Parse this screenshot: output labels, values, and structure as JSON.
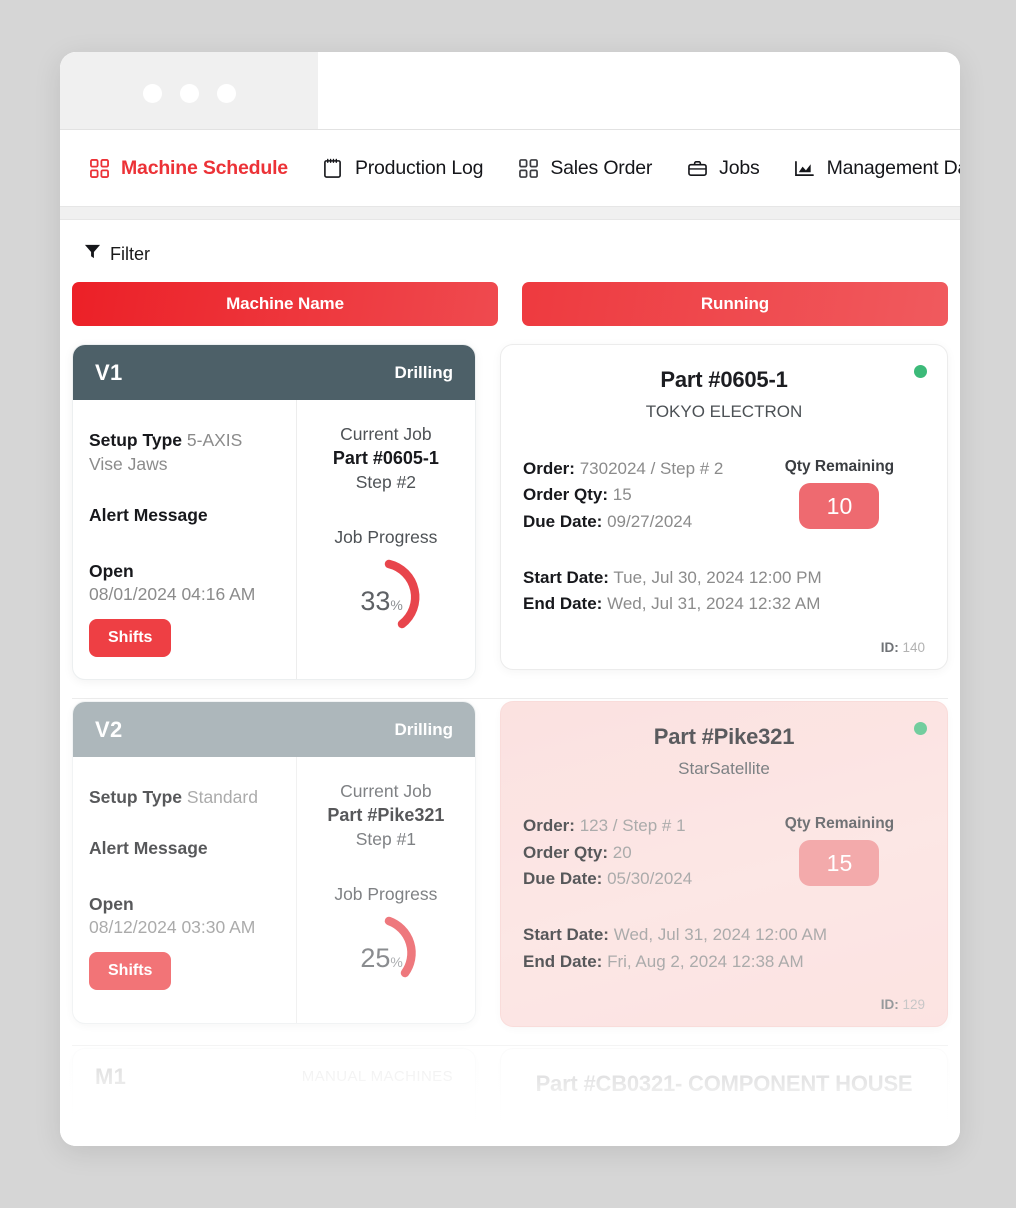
{
  "nav": {
    "items": [
      {
        "label": "Machine Schedule",
        "icon": "grid-icon",
        "active": true
      },
      {
        "label": "Production Log",
        "icon": "notepad-icon",
        "active": false
      },
      {
        "label": "Sales Order",
        "icon": "grid-icon",
        "active": false
      },
      {
        "label": "Jobs",
        "icon": "briefcase-icon",
        "active": false
      },
      {
        "label": "Management Dash",
        "icon": "chart-icon",
        "active": false
      }
    ]
  },
  "toolbar": {
    "filter_label": "Filter"
  },
  "columns": {
    "left_label": "Machine Name",
    "right_label": "Running"
  },
  "colors": {
    "accent_red": "#ec2027",
    "machine_header_active": "#4d6068",
    "machine_header_idle": "#8e9ca1",
    "status_green": "#3cba79",
    "qty_badge": "#ee6a70",
    "overdue_card": "#fad7d5"
  },
  "rows": [
    {
      "machine": {
        "name": "V1",
        "operation": "Drilling",
        "setup_type_label": "Setup Type",
        "setup_type_value": "5-AXIS Vise Jaws",
        "alert_message_label": "Alert Message",
        "open_label": "Open",
        "open_date": "08/01/2024 04:16 AM",
        "shifts_label": "Shifts",
        "current_job_label": "Current Job",
        "current_job_part": "Part #0605-1",
        "current_job_step": "Step #2",
        "job_progress_label": "Job Progress",
        "job_progress_value": 33,
        "job_progress_text": "33",
        "job_progress_unit": "%"
      },
      "job": {
        "part": "Part #0605-1",
        "customer": "TOKYO ELECTRON",
        "order_label": "Order:",
        "order_value": "7302024 / Step # 2",
        "order_qty_label": "Order Qty:",
        "order_qty_value": "15",
        "due_date_label": "Due Date:",
        "due_date_value": "09/27/2024",
        "qty_remaining_label": "Qty Remaining",
        "qty_remaining_value": "10",
        "start_date_label": "Start Date:",
        "start_date_value": "Tue, Jul 30, 2024 12:00 PM",
        "end_date_label": "End Date:",
        "end_date_value": "Wed, Jul 31, 2024 12:32 AM",
        "id_label": "ID:",
        "id_value": "140",
        "status": "running"
      }
    },
    {
      "machine": {
        "name": "V2",
        "operation": "Drilling",
        "setup_type_label": "Setup Type",
        "setup_type_value": "Standard",
        "alert_message_label": "Alert Message",
        "open_label": "Open",
        "open_date": "08/12/2024 03:30 AM",
        "shifts_label": "Shifts",
        "current_job_label": "Current Job",
        "current_job_part": "Part #Pike321",
        "current_job_step": "Step #1",
        "job_progress_label": "Job Progress",
        "job_progress_value": 25,
        "job_progress_text": "25",
        "job_progress_unit": "%"
      },
      "job": {
        "part": "Part #Pike321",
        "customer": "StarSatellite",
        "order_label": "Order:",
        "order_value": "123 / Step # 1",
        "order_qty_label": "Order Qty:",
        "order_qty_value": "20",
        "due_date_label": "Due Date:",
        "due_date_value": "05/30/2024",
        "qty_remaining_label": "Qty Remaining",
        "qty_remaining_value": "15",
        "start_date_label": "Start Date:",
        "start_date_value": "Wed, Jul 31, 2024 12:00 AM",
        "end_date_label": "End Date:",
        "end_date_value": "Fri, Aug 2, 2024 12:38 AM",
        "id_label": "ID:",
        "id_value": "129",
        "status": "running"
      }
    },
    {
      "machine": {
        "name": "M1",
        "operation": "MANUAL MACHINES"
      },
      "job": {
        "part": "Part #CB0321- COMPONENT HOUSE"
      }
    }
  ]
}
